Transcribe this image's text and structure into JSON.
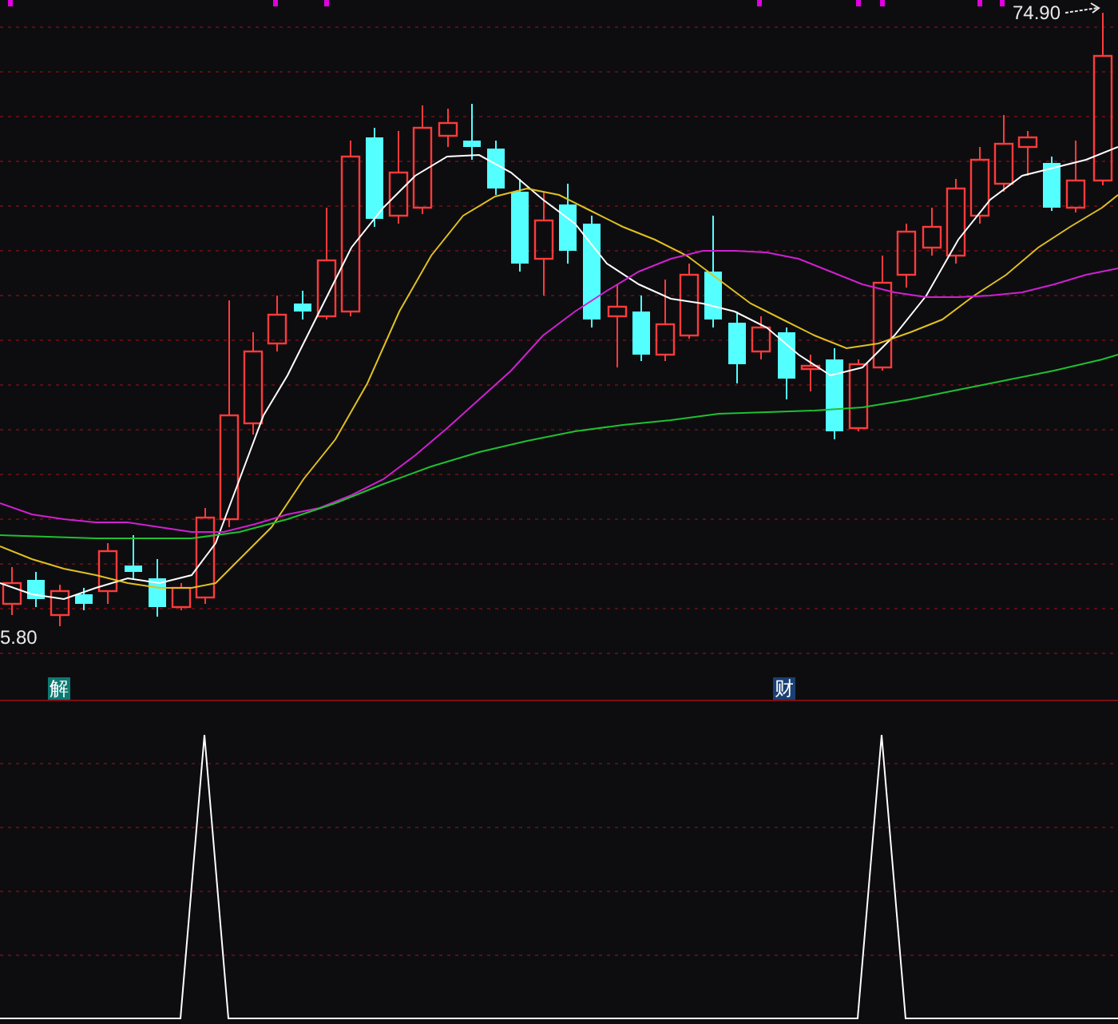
{
  "price_chart": {
    "high_label": "74.90",
    "low_label": "5.80"
  },
  "signal_markers": [
    {
      "label": "解",
      "color": "#0d7a72"
    },
    {
      "label": "财",
      "color": "#1b3f73"
    }
  ]
}
